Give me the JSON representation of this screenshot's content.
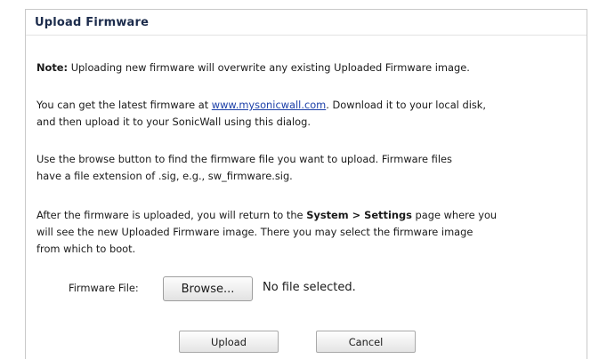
{
  "dialog": {
    "title": "Upload Firmware"
  },
  "note": {
    "label": "Note:",
    "text": " Uploading new firmware will overwrite any existing Uploaded Firmware image."
  },
  "latest": {
    "before_link": "You can get the latest firmware at ",
    "link": "www.mysonicwall.com",
    "after_link": ". Download it to your local disk,",
    "line2": "and then upload it to your SonicWall using this dialog."
  },
  "browse_info": {
    "line1": "Use the browse button to find the firmware file you want to upload. Firmware files",
    "line2": "have a file extension of .sig, e.g., sw_firmware.sig."
  },
  "after_upload": {
    "before_bold": "After the firmware is uploaded, you will return to the ",
    "bold": "System > Settings",
    "after_bold": " page where you",
    "line2": "will see the new Uploaded Firmware image. There you may select the firmware image",
    "line3": "from which to boot."
  },
  "file_row": {
    "label": "Firmware File:",
    "browse_label": "Browse...",
    "status": "No file selected."
  },
  "actions": {
    "upload_label": "Upload",
    "cancel_label": "Cancel"
  }
}
